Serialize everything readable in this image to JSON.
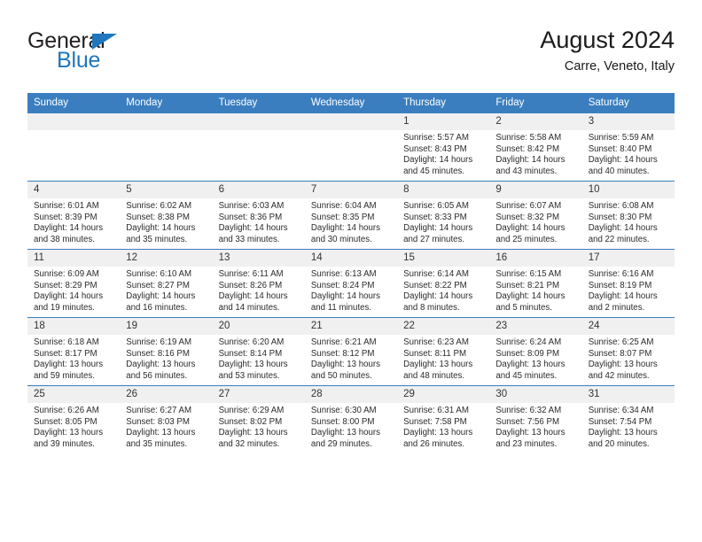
{
  "brand": {
    "name_part1": "General",
    "name_part2": "Blue",
    "triangle_icon": "triangle-icon",
    "color_dark": "#231f20",
    "color_blue": "#1f76bc"
  },
  "header": {
    "title": "August 2024",
    "subtitle": "Carre, Veneto, Italy"
  },
  "calendar": {
    "header_bg": "#3a7ebf",
    "daynum_bg": "#f0f0f0",
    "weekdays": [
      "Sunday",
      "Monday",
      "Tuesday",
      "Wednesday",
      "Thursday",
      "Friday",
      "Saturday"
    ],
    "weeks": [
      [
        {
          "day": "",
          "lines": []
        },
        {
          "day": "",
          "lines": []
        },
        {
          "day": "",
          "lines": []
        },
        {
          "day": "",
          "lines": []
        },
        {
          "day": "1",
          "lines": [
            "Sunrise: 5:57 AM",
            "Sunset: 8:43 PM",
            "Daylight: 14 hours",
            "and 45 minutes."
          ]
        },
        {
          "day": "2",
          "lines": [
            "Sunrise: 5:58 AM",
            "Sunset: 8:42 PM",
            "Daylight: 14 hours",
            "and 43 minutes."
          ]
        },
        {
          "day": "3",
          "lines": [
            "Sunrise: 5:59 AM",
            "Sunset: 8:40 PM",
            "Daylight: 14 hours",
            "and 40 minutes."
          ]
        }
      ],
      [
        {
          "day": "4",
          "lines": [
            "Sunrise: 6:01 AM",
            "Sunset: 8:39 PM",
            "Daylight: 14 hours",
            "and 38 minutes."
          ]
        },
        {
          "day": "5",
          "lines": [
            "Sunrise: 6:02 AM",
            "Sunset: 8:38 PM",
            "Daylight: 14 hours",
            "and 35 minutes."
          ]
        },
        {
          "day": "6",
          "lines": [
            "Sunrise: 6:03 AM",
            "Sunset: 8:36 PM",
            "Daylight: 14 hours",
            "and 33 minutes."
          ]
        },
        {
          "day": "7",
          "lines": [
            "Sunrise: 6:04 AM",
            "Sunset: 8:35 PM",
            "Daylight: 14 hours",
            "and 30 minutes."
          ]
        },
        {
          "day": "8",
          "lines": [
            "Sunrise: 6:05 AM",
            "Sunset: 8:33 PM",
            "Daylight: 14 hours",
            "and 27 minutes."
          ]
        },
        {
          "day": "9",
          "lines": [
            "Sunrise: 6:07 AM",
            "Sunset: 8:32 PM",
            "Daylight: 14 hours",
            "and 25 minutes."
          ]
        },
        {
          "day": "10",
          "lines": [
            "Sunrise: 6:08 AM",
            "Sunset: 8:30 PM",
            "Daylight: 14 hours",
            "and 22 minutes."
          ]
        }
      ],
      [
        {
          "day": "11",
          "lines": [
            "Sunrise: 6:09 AM",
            "Sunset: 8:29 PM",
            "Daylight: 14 hours",
            "and 19 minutes."
          ]
        },
        {
          "day": "12",
          "lines": [
            "Sunrise: 6:10 AM",
            "Sunset: 8:27 PM",
            "Daylight: 14 hours",
            "and 16 minutes."
          ]
        },
        {
          "day": "13",
          "lines": [
            "Sunrise: 6:11 AM",
            "Sunset: 8:26 PM",
            "Daylight: 14 hours",
            "and 14 minutes."
          ]
        },
        {
          "day": "14",
          "lines": [
            "Sunrise: 6:13 AM",
            "Sunset: 8:24 PM",
            "Daylight: 14 hours",
            "and 11 minutes."
          ]
        },
        {
          "day": "15",
          "lines": [
            "Sunrise: 6:14 AM",
            "Sunset: 8:22 PM",
            "Daylight: 14 hours",
            "and 8 minutes."
          ]
        },
        {
          "day": "16",
          "lines": [
            "Sunrise: 6:15 AM",
            "Sunset: 8:21 PM",
            "Daylight: 14 hours",
            "and 5 minutes."
          ]
        },
        {
          "day": "17",
          "lines": [
            "Sunrise: 6:16 AM",
            "Sunset: 8:19 PM",
            "Daylight: 14 hours",
            "and 2 minutes."
          ]
        }
      ],
      [
        {
          "day": "18",
          "lines": [
            "Sunrise: 6:18 AM",
            "Sunset: 8:17 PM",
            "Daylight: 13 hours",
            "and 59 minutes."
          ]
        },
        {
          "day": "19",
          "lines": [
            "Sunrise: 6:19 AM",
            "Sunset: 8:16 PM",
            "Daylight: 13 hours",
            "and 56 minutes."
          ]
        },
        {
          "day": "20",
          "lines": [
            "Sunrise: 6:20 AM",
            "Sunset: 8:14 PM",
            "Daylight: 13 hours",
            "and 53 minutes."
          ]
        },
        {
          "day": "21",
          "lines": [
            "Sunrise: 6:21 AM",
            "Sunset: 8:12 PM",
            "Daylight: 13 hours",
            "and 50 minutes."
          ]
        },
        {
          "day": "22",
          "lines": [
            "Sunrise: 6:23 AM",
            "Sunset: 8:11 PM",
            "Daylight: 13 hours",
            "and 48 minutes."
          ]
        },
        {
          "day": "23",
          "lines": [
            "Sunrise: 6:24 AM",
            "Sunset: 8:09 PM",
            "Daylight: 13 hours",
            "and 45 minutes."
          ]
        },
        {
          "day": "24",
          "lines": [
            "Sunrise: 6:25 AM",
            "Sunset: 8:07 PM",
            "Daylight: 13 hours",
            "and 42 minutes."
          ]
        }
      ],
      [
        {
          "day": "25",
          "lines": [
            "Sunrise: 6:26 AM",
            "Sunset: 8:05 PM",
            "Daylight: 13 hours",
            "and 39 minutes."
          ]
        },
        {
          "day": "26",
          "lines": [
            "Sunrise: 6:27 AM",
            "Sunset: 8:03 PM",
            "Daylight: 13 hours",
            "and 35 minutes."
          ]
        },
        {
          "day": "27",
          "lines": [
            "Sunrise: 6:29 AM",
            "Sunset: 8:02 PM",
            "Daylight: 13 hours",
            "and 32 minutes."
          ]
        },
        {
          "day": "28",
          "lines": [
            "Sunrise: 6:30 AM",
            "Sunset: 8:00 PM",
            "Daylight: 13 hours",
            "and 29 minutes."
          ]
        },
        {
          "day": "29",
          "lines": [
            "Sunrise: 6:31 AM",
            "Sunset: 7:58 PM",
            "Daylight: 13 hours",
            "and 26 minutes."
          ]
        },
        {
          "day": "30",
          "lines": [
            "Sunrise: 6:32 AM",
            "Sunset: 7:56 PM",
            "Daylight: 13 hours",
            "and 23 minutes."
          ]
        },
        {
          "day": "31",
          "lines": [
            "Sunrise: 6:34 AM",
            "Sunset: 7:54 PM",
            "Daylight: 13 hours",
            "and 20 minutes."
          ]
        }
      ]
    ]
  }
}
